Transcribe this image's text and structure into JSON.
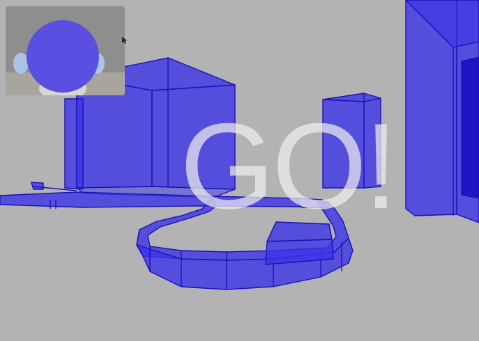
{
  "overlay": {
    "go_text": "GO!"
  },
  "webcam": {
    "icon": "face-blur-circle-icon",
    "blur_color": "#5a4fe0"
  },
  "cursor": {
    "icon": "mouse-pointer-icon"
  },
  "scene": {
    "background_color": "#b3b3b3",
    "wall_fill": "#3d33e6",
    "wall_opacity": 0.8,
    "edge_color": "#1a12b8"
  }
}
